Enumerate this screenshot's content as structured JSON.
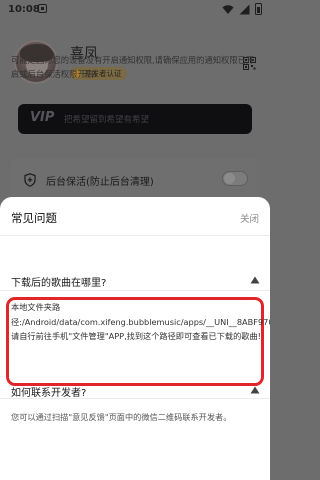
{
  "status_bar": {
    "time": "10:08"
  },
  "profile": {
    "username": "喜凤",
    "badge": "开发者认证"
  },
  "vip": {
    "logo": "VIP",
    "tagline": "把希望留到希望有希望"
  },
  "keepalive": {
    "label": "后台保活(防止后台清理)"
  },
  "sheet": {
    "title": "常见问题",
    "close_label": "关闭",
    "intro": "可能是因为您的设备没有开启通知权限,请确保应用的通知权限已开启或后台保活权限开启!",
    "faqs": [
      {
        "question": "下载后的歌曲在哪里?",
        "answer": "本地文件夹路径:/Android/data/com.xifeng.bubblemusic/apps/__UNI__8ABF970/doc/uniapp_save/ 请自行前往手机\"文件管理\"APP,找到这个路径即可查看已下载的歌曲!"
      },
      {
        "question": "如何联系开发者?",
        "answer": "您可以通过扫描\"意见反馈\"页面中的微信二维码联系开发者。"
      }
    ]
  },
  "colors": {
    "highlight_border": "#e0252b",
    "badge": "#b2822a"
  }
}
